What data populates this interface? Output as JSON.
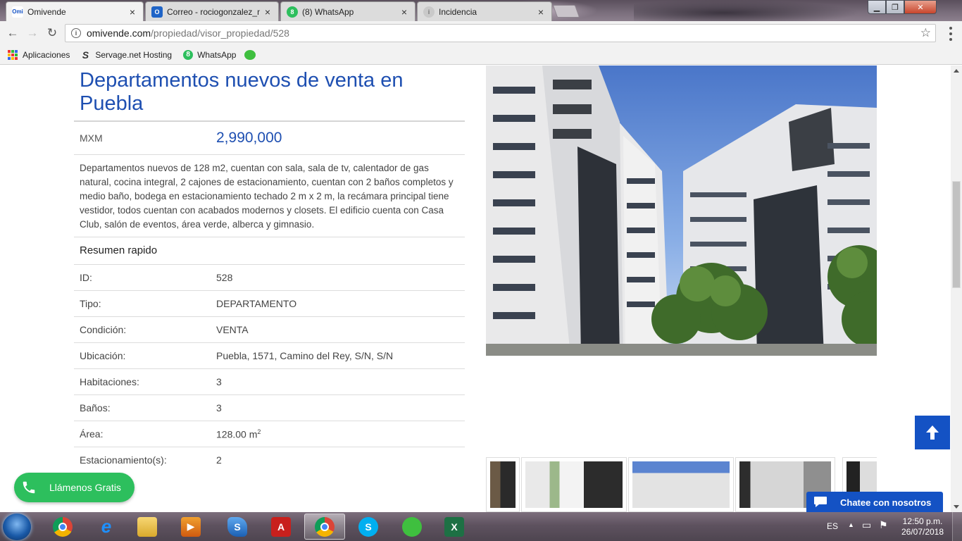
{
  "browser": {
    "tabs": [
      {
        "title": "Omivende",
        "active": true
      },
      {
        "title": "Correo - rociogonzalez_n",
        "active": false
      },
      {
        "title": "(8) WhatsApp",
        "active": false
      },
      {
        "title": "Incidencia",
        "active": false
      }
    ],
    "close_glyph": "×",
    "url_domain": "omivende.com",
    "url_path": "/propiedad/visor_propiedad/528",
    "bookmarks": [
      {
        "label": "Aplicaciones",
        "icon": "apps-grid-icon"
      },
      {
        "label": "Servage.net Hosting",
        "icon": "servage-icon"
      },
      {
        "label": "WhatsApp",
        "icon": "whatsapp-icon"
      },
      {
        "label": "",
        "icon": "wechat-icon"
      }
    ]
  },
  "property": {
    "title": "Departamentos nuevos de venta en Puebla",
    "currency": "MXM",
    "price": "2,990,000",
    "description": "Departamentos nuevos de 128 m2, cuentan con sala, sala de tv, calentador de gas natural, cocina integral, 2 cajones de estacionamiento, cuentan con 2 baños completos y medio baño, bodega en estacionamiento techado 2 m x 2 m, la recámara principal tiene vestidor, todos cuentan con acabados modernos y closets. El edificio cuenta con Casa Club, salón de eventos, área verde, alberca y gimnasio.",
    "summary_title": "Resumen rapido",
    "summary": [
      {
        "label": "ID:",
        "value": "528"
      },
      {
        "label": "Tipo:",
        "value": "DEPARTAMENTO"
      },
      {
        "label": "Condición:",
        "value": "VENTA"
      },
      {
        "label": "Ubicación:",
        "value": "Puebla, 1571, Camino del Rey, S/N, S/N"
      },
      {
        "label": "Habitaciones:",
        "value": "3"
      },
      {
        "label": "Baños:",
        "value": "3"
      },
      {
        "label": "Área:",
        "value": "128.00 m",
        "sup": "2"
      },
      {
        "label": "Estacionamiento(s):",
        "value": "2"
      }
    ]
  },
  "widgets": {
    "call_label": "Llámenos Gratis",
    "chat_label": "Chatee con nosotros"
  },
  "taskbar": {
    "language": "ES",
    "time": "12:50 p.m.",
    "date": "26/07/2018"
  },
  "colors": {
    "brand_blue": "#1e4fb1",
    "button_blue": "#1452c4",
    "call_green": "#2dbf5d"
  }
}
